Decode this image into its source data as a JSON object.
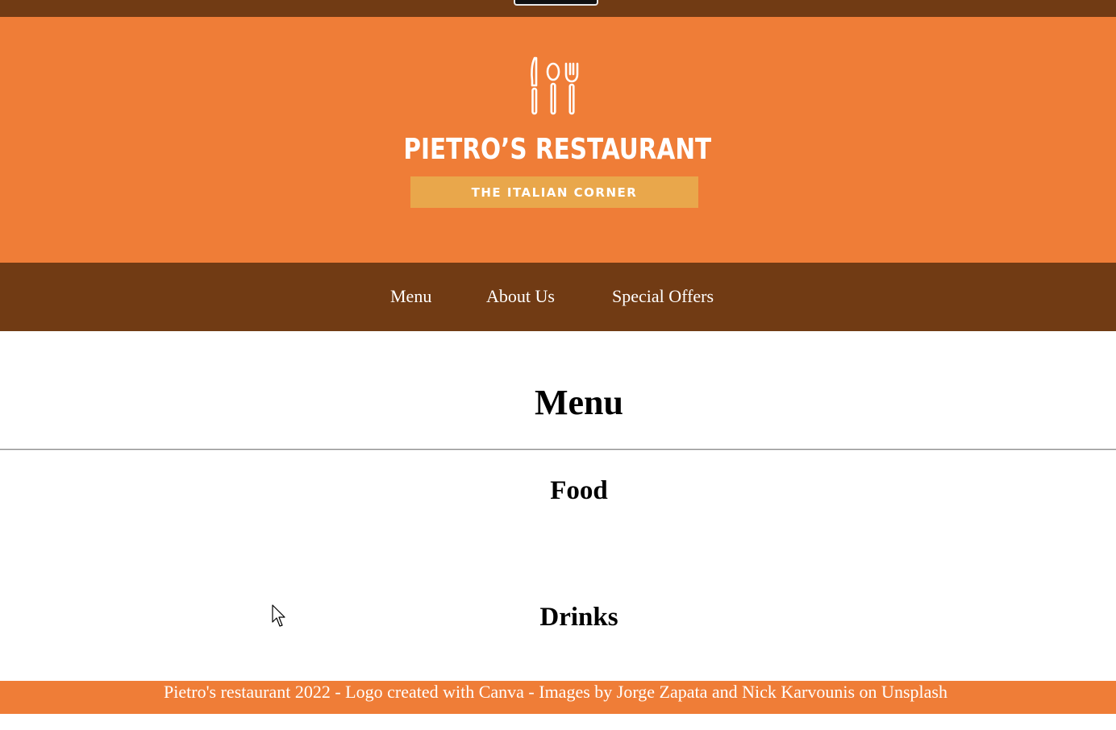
{
  "colors": {
    "dark_brown": "#713b14",
    "orange": "#ef7d37",
    "tagline_gold": "#e9a74b",
    "text_white": "#ffffff"
  },
  "logo": {
    "icon": "fork-spoon-knife-icon",
    "title": "PIETRO’S RESTAURANT",
    "tagline": "THE ITALIAN CORNER"
  },
  "nav": {
    "items": [
      {
        "label": "Menu"
      },
      {
        "label": "About Us"
      },
      {
        "label": "Special Offers"
      }
    ]
  },
  "main": {
    "title": "Menu",
    "sections": [
      {
        "heading": "Food"
      },
      {
        "heading": "Drinks"
      }
    ]
  },
  "footer": {
    "text": "Pietro's restaurant 2022 - Logo created with Canva - Images by Jorge Zapata and Nick Karvounis on Unsplash"
  }
}
